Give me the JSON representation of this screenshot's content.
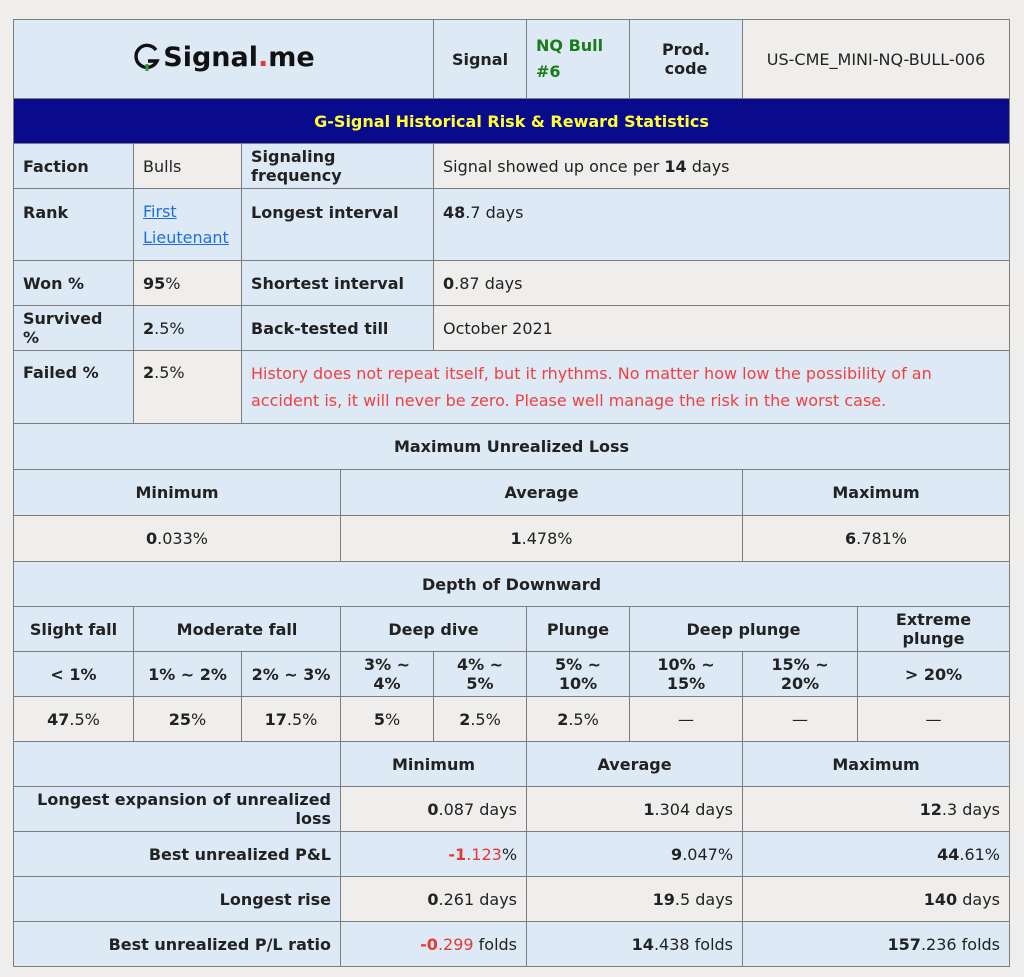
{
  "header": {
    "logo_text": "Signal",
    "logo_dot": ".",
    "logo_suffix": "me",
    "signal_label": "Signal",
    "signal_name_line1": "NQ Bull",
    "signal_name_line2": "#6",
    "prod_code_label": "Prod. code",
    "prod_code": "US-CME_MINI-NQ-BULL-006"
  },
  "title": "G-Signal Historical Risk & Reward Statistics",
  "stats": {
    "faction_label": "Faction",
    "faction": "Bulls",
    "rank_label": "Rank",
    "rank_line1": "First",
    "rank_line2": "Lieutenant",
    "won_label": "Won %",
    "won_bold": "95",
    "won_rest": "%",
    "survived_label": "Survived %",
    "survived_bold": "2",
    "survived_rest": ".5%",
    "failed_label": "Failed %",
    "failed_bold": "2",
    "failed_rest": ".5%",
    "freq_label": "Signaling frequency",
    "freq_pre": "Signal showed up once per ",
    "freq_bold": "14",
    "freq_post": " days",
    "longest_label": "Longest interval",
    "longest_bold": "48",
    "longest_rest": ".7 days",
    "shortest_label": "Shortest interval",
    "shortest_bold": "0",
    "shortest_rest": ".87 days",
    "backtest_label": "Back-tested till",
    "backtest_value": "October 2021",
    "disclaimer": "History does not repeat itself, but it rhythms. No matter how low the possibility of an accident is, it will never be zero. Please well manage the risk in the worst case."
  },
  "mul": {
    "title": "Maximum Unrealized Loss",
    "min_label": "Minimum",
    "avg_label": "Average",
    "max_label": "Maximum",
    "min_bold": "0",
    "min_rest": ".033%",
    "avg_bold": "1",
    "avg_rest": ".478%",
    "max_bold": "6",
    "max_rest": ".781%"
  },
  "depth": {
    "title": "Depth of Downward",
    "groups": [
      "Slight fall",
      "Moderate fall",
      "Deep dive",
      "Plunge",
      "Deep plunge",
      "Extreme plunge"
    ],
    "ranges": [
      "< 1%",
      "1% ~ 2%",
      "2% ~ 3%",
      "3% ~ 4%",
      "4% ~ 5%",
      "5% ~ 10%",
      "10% ~ 15%",
      "15% ~ 20%",
      "> 20%"
    ],
    "values_bold": [
      "47",
      "25",
      "17",
      "5",
      "2",
      "2",
      "—",
      "—",
      "—"
    ],
    "values_rest": [
      ".5%",
      "%",
      ".5%",
      "%",
      ".5%",
      ".5%",
      "",
      "",
      ""
    ]
  },
  "perf": {
    "min_label": "Minimum",
    "avg_label": "Average",
    "max_label": "Maximum",
    "rows": [
      {
        "label": "Longest expansion of unrealized loss",
        "min_b": "0",
        "min_r": ".087 days",
        "avg_b": "1",
        "avg_r": ".304 days",
        "max_b": "12",
        "max_r": ".3 days"
      },
      {
        "label": "Best unrealized P&L",
        "min_b": "-1",
        "min_r": ".123",
        "min_pct": "%",
        "avg_b": "9",
        "avg_r": ".047%",
        "max_b": "44",
        "max_r": ".61%"
      },
      {
        "label": "Longest rise",
        "min_b": "0",
        "min_r": ".261 days",
        "avg_b": "19",
        "avg_r": ".5 days",
        "max_b": "140",
        "max_r": " days"
      },
      {
        "label": "Best unrealized P/L ratio",
        "min_b": "-0",
        "min_r": ".299",
        "min_post": " folds",
        "avg_b": "14",
        "avg_r": ".438 folds",
        "max_b": "157",
        "max_r": ".236 folds"
      }
    ]
  },
  "colors": {
    "title_bg": "#0a0a8c",
    "title_fg": "#ffff33",
    "header_blue": "#dde9f5",
    "negative": "#e53935",
    "signal_green": "#1a7d1a"
  }
}
